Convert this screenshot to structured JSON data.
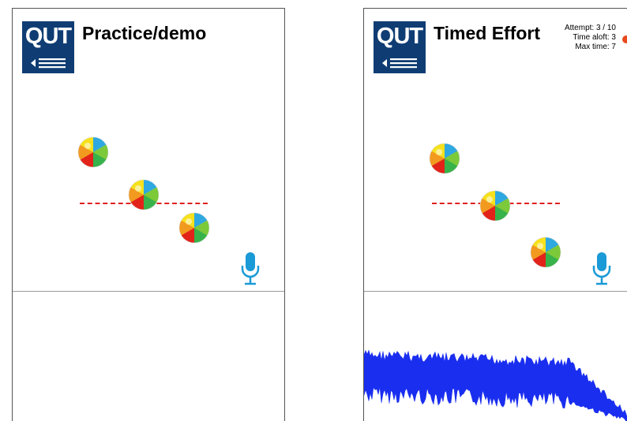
{
  "left_screen": {
    "logo_text": "QUT",
    "title": "Practice/demo"
  },
  "right_screen": {
    "logo_text": "QUT",
    "title": "Timed Effort",
    "stats": {
      "attempt": "Attempt: 3 / 10",
      "time_aloft": "Time aloft: 3",
      "max_time": "Max time: 7"
    }
  },
  "icons": {
    "logo": "qut-logo",
    "menu": "back-menu-icon",
    "ball": "beach-ball-icon",
    "microphone": "microphone-icon"
  },
  "colors": {
    "brand": "#0f3d73",
    "target_line": "#e02020",
    "microphone": "#1a9ad6",
    "waveform": "#1a2ef0",
    "status_dot": "#e8491d"
  }
}
